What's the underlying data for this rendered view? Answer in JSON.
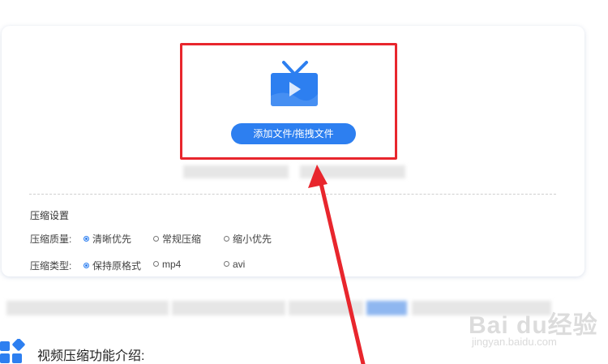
{
  "upload": {
    "add_button_label": "添加文件/拖拽文件"
  },
  "settings": {
    "title": "压缩设置",
    "quality": {
      "label": "压缩质量:",
      "options": [
        "清晰优先",
        "常规压缩",
        "缩小优先"
      ],
      "selected": "清晰优先"
    },
    "type": {
      "label": "压缩类型:",
      "options": [
        "保持原格式",
        "mp4",
        "avi"
      ],
      "selected": "保持原格式"
    }
  },
  "intro": {
    "heading": "视频压缩功能介绍:"
  },
  "watermark": {
    "brand": "Bai du经验",
    "url": "jingyan.baidu.com"
  },
  "colors": {
    "accent": "#2d7ff0",
    "annotation_red": "#e8262d"
  },
  "icons": [
    "tv-play-icon",
    "app-grid-icon",
    "annotation-arrow"
  ]
}
